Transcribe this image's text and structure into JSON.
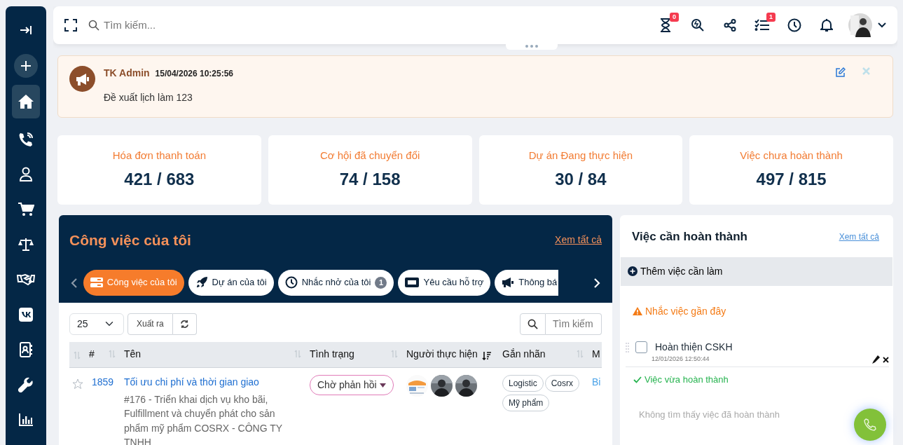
{
  "sidebar": {
    "items": [
      {
        "kind": "collapse",
        "selected": false
      },
      {
        "kind": "add",
        "selected": false
      },
      {
        "kind": "home",
        "selected": true
      },
      {
        "kind": "phone",
        "selected": false
      },
      {
        "kind": "user",
        "selected": false
      },
      {
        "kind": "cart",
        "selected": false
      },
      {
        "kind": "scale",
        "selected": false
      },
      {
        "kind": "handshake",
        "selected": false
      },
      {
        "kind": "vk",
        "selected": false
      },
      {
        "kind": "contacts",
        "selected": false
      },
      {
        "kind": "wrench",
        "selected": false
      },
      {
        "kind": "chart",
        "selected": false
      }
    ]
  },
  "header": {
    "search_placeholder": "Tìm kiếm...",
    "actions": [
      {
        "kind": "hourglass",
        "badge": "0"
      },
      {
        "kind": "search-refresh"
      },
      {
        "kind": "share"
      },
      {
        "kind": "tasks",
        "badge": "1"
      },
      {
        "kind": "clock"
      },
      {
        "kind": "bell"
      }
    ]
  },
  "announcement": {
    "author": "TK Admin",
    "time": "15/04/2026 10:25:56",
    "message": "Đề xuất lịch làm 123"
  },
  "stats": [
    {
      "label": "Hóa đơn thanh toán",
      "value": "421 / 683"
    },
    {
      "label": "Cơ hội đã chuyển đổi",
      "value": "74 / 158"
    },
    {
      "label": "Dự án Đang thực hiện",
      "value": "30 / 84"
    },
    {
      "label": "Việc chưa hoàn thành",
      "value": "497 / 815"
    }
  ],
  "tasks_panel": {
    "title": "Công việc của tôi",
    "view_all": "Xem tất cả",
    "tabs": [
      {
        "kind": "tasks",
        "label": "Công việc của tôi",
        "selected": true
      },
      {
        "kind": "project",
        "label": "Dự án của tôi",
        "selected": false
      },
      {
        "kind": "reminder",
        "label": "Nhắc nhở của tôi",
        "count": "1",
        "selected": false
      },
      {
        "kind": "ticket",
        "label": "Yêu cầu hỗ trợ",
        "selected": false
      },
      {
        "kind": "announce",
        "label": "Thông bá",
        "selected": false
      }
    ],
    "page_size": "25",
    "export_label": "Xuất ra",
    "search_placeholder": "Tìm kiếm",
    "table": {
      "columns": [
        {
          "label": "#",
          "sorted": false
        },
        {
          "label": "Tên",
          "sorted": false
        },
        {
          "label": "Tình trạng",
          "sorted": false
        },
        {
          "label": "Người thực hiện",
          "sorted": true
        },
        {
          "label": "Gắn nhãn",
          "sorted": false
        },
        {
          "label": "M"
        }
      ],
      "rows": [
        {
          "starred": false,
          "id": "1859",
          "title": "Tối ưu chi phí và thời gian giao",
          "description": "#176 - Triển khai dịch vụ kho bãi, Fulfillment và chuyển phát cho sản phẩm mỹ phẩm COSRX - CÔNG TY TNHH",
          "status": "Chờ phản hồi",
          "assignees": [
            {
              "kind": "logo"
            },
            {
              "kind": "picture"
            },
            {
              "kind": "picture"
            }
          ],
          "tags": [
            "Logistic",
            "Cosrx",
            "Mỹ phẩm"
          ],
          "column_6": "Bi"
        }
      ]
    }
  },
  "todo_panel": {
    "title": "Việc cần hoàn thành",
    "view_all": "Xem tất cả",
    "add_label": "Thêm việc cần làm",
    "reminders_heading": "Nhắc việc gần đây",
    "todos": [
      {
        "text": "Hoàn thiện CSKH",
        "time": "12/01/2026 12:50:44",
        "checked": false
      }
    ],
    "done_heading": "Việc vừa hoàn thành",
    "empty_text": "Không tìm thấy việc đã hoàn thành"
  }
}
